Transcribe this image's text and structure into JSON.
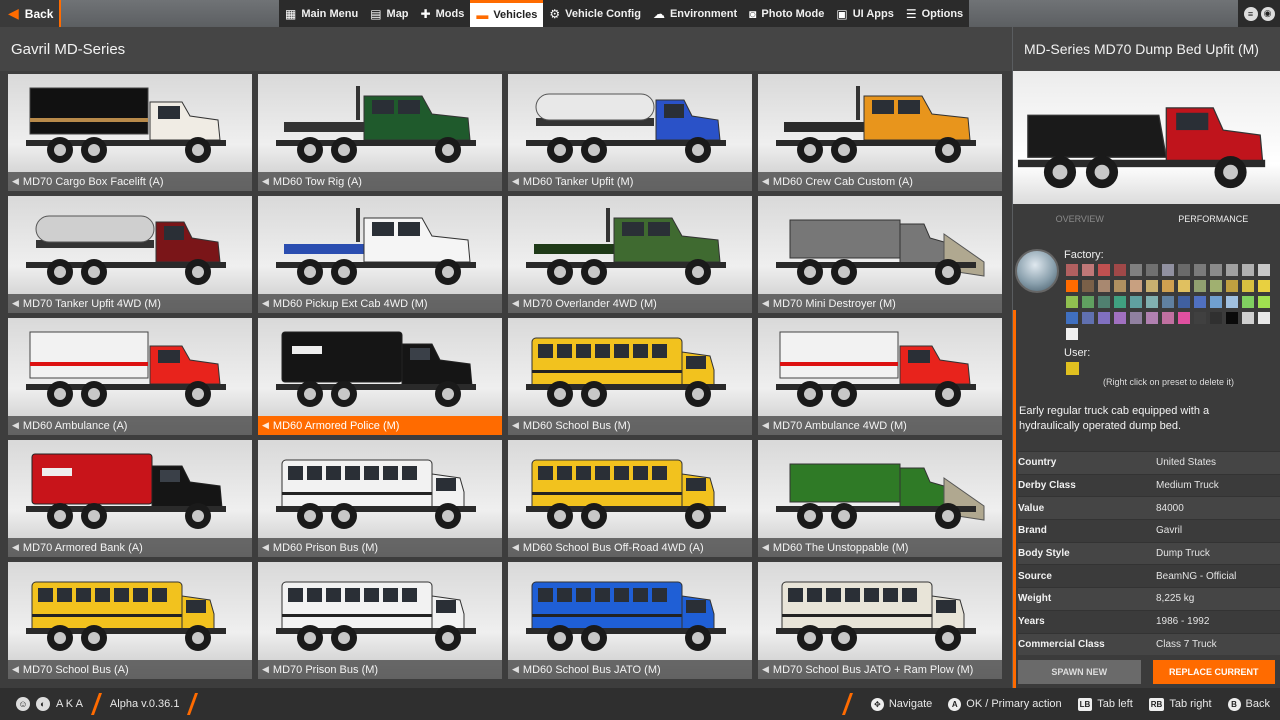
{
  "topbar": {
    "back_label": "Back",
    "menu": [
      {
        "label": "Main Menu",
        "icon": "grid-icon"
      },
      {
        "label": "Map",
        "icon": "map-icon"
      },
      {
        "label": "Mods",
        "icon": "puzzle-icon"
      },
      {
        "label": "Vehicles",
        "icon": "car-icon",
        "active": true
      },
      {
        "label": "Vehicle Config",
        "icon": "engine-icon"
      },
      {
        "label": "Environment",
        "icon": "weather-icon"
      },
      {
        "label": "Photo Mode",
        "icon": "camera-icon"
      },
      {
        "label": "UI Apps",
        "icon": "apps-icon"
      },
      {
        "label": "Options",
        "icon": "sliders-icon"
      }
    ]
  },
  "list": {
    "title": "Gavril MD-Series",
    "vehicles": [
      {
        "label": "MD70 Cargo Box Facelift (A)",
        "body": "box",
        "color": "#f0ece4",
        "cargo": "#111111"
      },
      {
        "label": "MD60 Tow Rig (A)",
        "body": "flatbed",
        "color": "#1f5a2c",
        "cargo": "#333333"
      },
      {
        "label": "MD60 Tanker Upfit (M)",
        "body": "tanker",
        "color": "#2a52c8",
        "cargo": "#e8e8e8"
      },
      {
        "label": "MD60 Crew Cab Custom (A)",
        "body": "crew",
        "color": "#e8951c",
        "cargo": "#2a2a2a"
      },
      {
        "label": "MD70 Tanker Upfit 4WD (M)",
        "body": "tanker",
        "color": "#7a1518",
        "cargo": "#cfcfcf"
      },
      {
        "label": "MD60 Pickup Ext Cab 4WD (M)",
        "body": "crew",
        "color": "#f5f5f5",
        "cargo": "#2a4db0"
      },
      {
        "label": "MD70 Overlander 4WD (M)",
        "body": "crew",
        "color": "#3f6a30",
        "cargo": "#1f3a18"
      },
      {
        "label": "MD70 Mini Destroyer (M)",
        "body": "plow",
        "color": "#777777",
        "cargo": "#999999"
      },
      {
        "label": "MD60 Ambulance (A)",
        "body": "box",
        "color": "#e8231c",
        "cargo": "#f2f2f2"
      },
      {
        "label": "MD60 Armored Police (M)",
        "body": "armored",
        "color": "#151515",
        "cargo": "#151515",
        "selected": true
      },
      {
        "label": "MD60 School Bus (M)",
        "body": "bus",
        "color": "#f2c21e",
        "cargo": "#f2c21e"
      },
      {
        "label": "MD70 Ambulance 4WD (M)",
        "body": "box",
        "color": "#e8231c",
        "cargo": "#f2f2f2"
      },
      {
        "label": "MD70 Armored Bank (A)",
        "body": "armored",
        "color": "#c8141a",
        "cargo": "#c8141a"
      },
      {
        "label": "MD60 Prison Bus (M)",
        "body": "bus",
        "color": "#f2f2f2",
        "cargo": "#f2f2f2"
      },
      {
        "label": "MD60 School Bus Off-Road 4WD (A)",
        "body": "bus",
        "color": "#f2c21e",
        "cargo": "#f2c21e"
      },
      {
        "label": "MD60 The Unstoppable (M)",
        "body": "plow",
        "color": "#2f7a26",
        "cargo": "#f2f2f2"
      },
      {
        "label": "MD70 School Bus (A)",
        "body": "bus",
        "color": "#f2c21e",
        "cargo": "#f2c21e"
      },
      {
        "label": "MD70 Prison Bus (M)",
        "body": "bus",
        "color": "#f2f2f2",
        "cargo": "#f2f2f2"
      },
      {
        "label": "MD60 School Bus JATO (M)",
        "body": "bus",
        "color": "#1f5fd6",
        "cargo": "#1f5fd6"
      },
      {
        "label": "MD70 School Bus JATO + Ram Plow (M)",
        "body": "bus",
        "color": "#e8e4d8",
        "cargo": "#e8e4d8"
      }
    ]
  },
  "detail": {
    "title": "MD-Series MD70 Dump Bed Upfit (M)",
    "preview": {
      "body": "dump",
      "color": "#c0141c",
      "cargo": "#1a1a1a"
    },
    "tabs": [
      "OVERVIEW",
      "PERFORMANCE"
    ],
    "factory_label": "Factory:",
    "user_label": "User:",
    "paint_hint": "(Right click on preset to delete it)",
    "swatches": [
      "#b26060",
      "#c07878",
      "#c05050",
      "#a04848",
      "#808080",
      "#707070",
      "#9090a0",
      "#6a6a6a",
      "#7a7a7a",
      "#8a8a8a",
      "#a0a0a0",
      "#b0b0b0",
      "#c8c8c8",
      "#ff6b00",
      "#7a6048",
      "#a88870",
      "#b09060",
      "#c8a080",
      "#c8b070",
      "#d0a050",
      "#e0c060",
      "#90a070",
      "#a0b070",
      "#c0a040",
      "#d8c040",
      "#e8d040",
      "#90c050",
      "#60a060",
      "#508070",
      "#40a080",
      "#60a0a0",
      "#80b0b0",
      "#6080a0",
      "#4060a0",
      "#5070c0",
      "#70a0d0",
      "#a0c0e0",
      "#80d060",
      "#a0e050",
      "#4070c0",
      "#6070b0",
      "#8070c0",
      "#a070c0",
      "#9080a0",
      "#b080b0",
      "#c070a0",
      "#e050a0",
      "#404040",
      "#303030",
      "#0a0a0a",
      "#d0d0d0",
      "#e8e8e8",
      "#f0f0f0"
    ],
    "user_swatch": "#e0c020",
    "description": "Early regular truck cab equipped with a hydraulically operated dump bed.",
    "info": [
      {
        "key": "Country",
        "value": "United States"
      },
      {
        "key": "Derby Class",
        "value": "Medium Truck"
      },
      {
        "key": "Value",
        "value": "84000"
      },
      {
        "key": "Brand",
        "value": "Gavril"
      },
      {
        "key": "Body Style",
        "value": "Dump Truck"
      },
      {
        "key": "Source",
        "value": "BeamNG - Official"
      },
      {
        "key": "Weight",
        "value": "8,225 kg"
      },
      {
        "key": "Years",
        "value": "1986 - 1992"
      },
      {
        "key": "Commercial Class",
        "value": "Class 7 Truck"
      }
    ],
    "spawn_label": "SPAWN NEW",
    "replace_label": "REPLACE CURRENT"
  },
  "bottombar": {
    "user": "A K A",
    "version": "Alpha v.0.36.1",
    "hints": [
      {
        "key": "✥",
        "label": "Navigate"
      },
      {
        "key": "A",
        "label": "OK / Primary action"
      },
      {
        "key": "LB",
        "label": "Tab left"
      },
      {
        "key": "RB",
        "label": "Tab right"
      },
      {
        "key": "B",
        "label": "Back"
      }
    ]
  }
}
